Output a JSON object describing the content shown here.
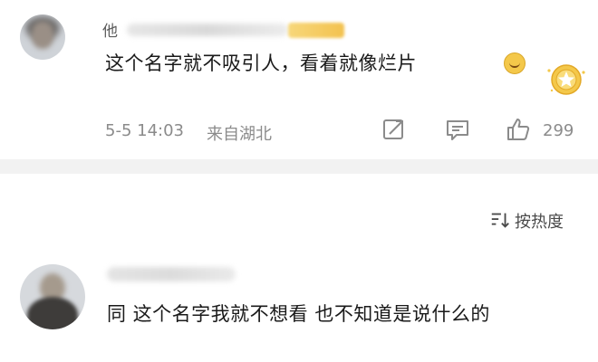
{
  "comment1": {
    "username_visible": "他",
    "text": "这个名字就不吸引人，看着就像烂片",
    "timestamp": "5-5 14:03",
    "source": "来自湖北",
    "like_count": "299",
    "emoji_icon": "laugh-cry-emoji-icon",
    "badge_icon": "gold-medal-icon"
  },
  "sort": {
    "label": "按热度",
    "icon": "sort-icon"
  },
  "comment2": {
    "text": "同 这个名字我就不想看 也不知道是说什么的"
  },
  "colors": {
    "text_primary": "#1a1a1a",
    "text_secondary": "#8b8b8b",
    "divider": "#f2f2f2",
    "medal_gold": "#f4c84a"
  }
}
